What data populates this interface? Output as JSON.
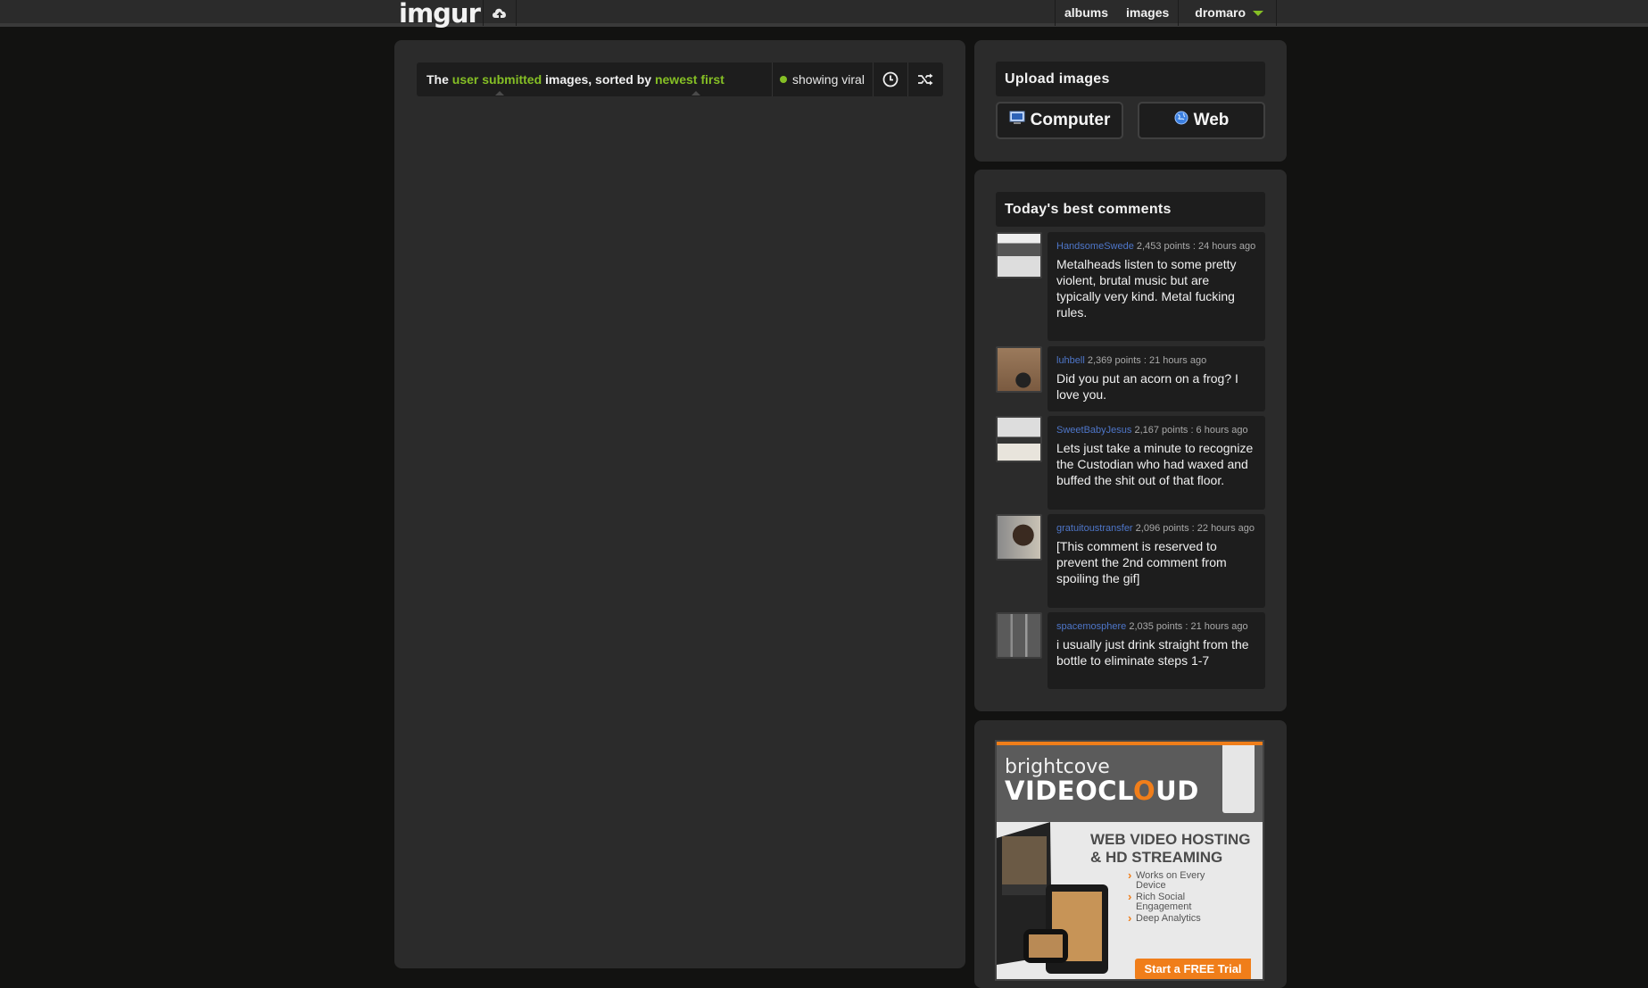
{
  "header": {
    "logo": "imgur",
    "nav": {
      "albums": "albums",
      "images": "images",
      "user": "dromaro"
    }
  },
  "gallery": {
    "sort": {
      "prefix": "The",
      "source": "user submitted",
      "middle": "images, sorted by",
      "order": "newest first",
      "filter": "showing viral"
    }
  },
  "upload": {
    "title": "Upload images",
    "computer_label": "Computer",
    "web_label": "Web"
  },
  "comments": {
    "title": "Today's best comments",
    "items": [
      {
        "user": "HandsomeSwede",
        "meta": "2,453 points : 24 hours ago",
        "text": "Metalheads listen to some pretty violent, brutal music but are typically very kind. Metal fucking rules."
      },
      {
        "user": "luhbell",
        "meta": "2,369 points : 21 hours ago",
        "text": "Did you put an acorn on a frog? I love you."
      },
      {
        "user": "SweetBabyJesus",
        "meta": "2,167 points : 6 hours ago",
        "text": "Lets just take a minute to recognize the Custodian who had waxed and buffed the shit out of that floor."
      },
      {
        "user": "gratuitoustransfer",
        "meta": "2,096 points : 22 hours ago",
        "text": "[This comment is reserved to prevent the 2nd comment from spoiling the gif]"
      },
      {
        "user": "spacemosphere",
        "meta": "2,035 points : 21 hours ago",
        "text": "i usually just drink straight from the bottle to eliminate steps 1-7"
      }
    ]
  },
  "ad": {
    "brand": "brightcove",
    "product_a": "VIDEOCL",
    "product_o": "O",
    "product_b": "UD",
    "headline": "WEB VIDEO HOSTING & HD STREAMING",
    "bullets": [
      "Works on Every Device",
      "Rich Social Engagement",
      "Deep Analytics"
    ],
    "cta": "Start a FREE Trial"
  },
  "colors": {
    "accent": "#85bf25",
    "link": "#4e76c9",
    "ad_orange": "#f07e1a"
  }
}
